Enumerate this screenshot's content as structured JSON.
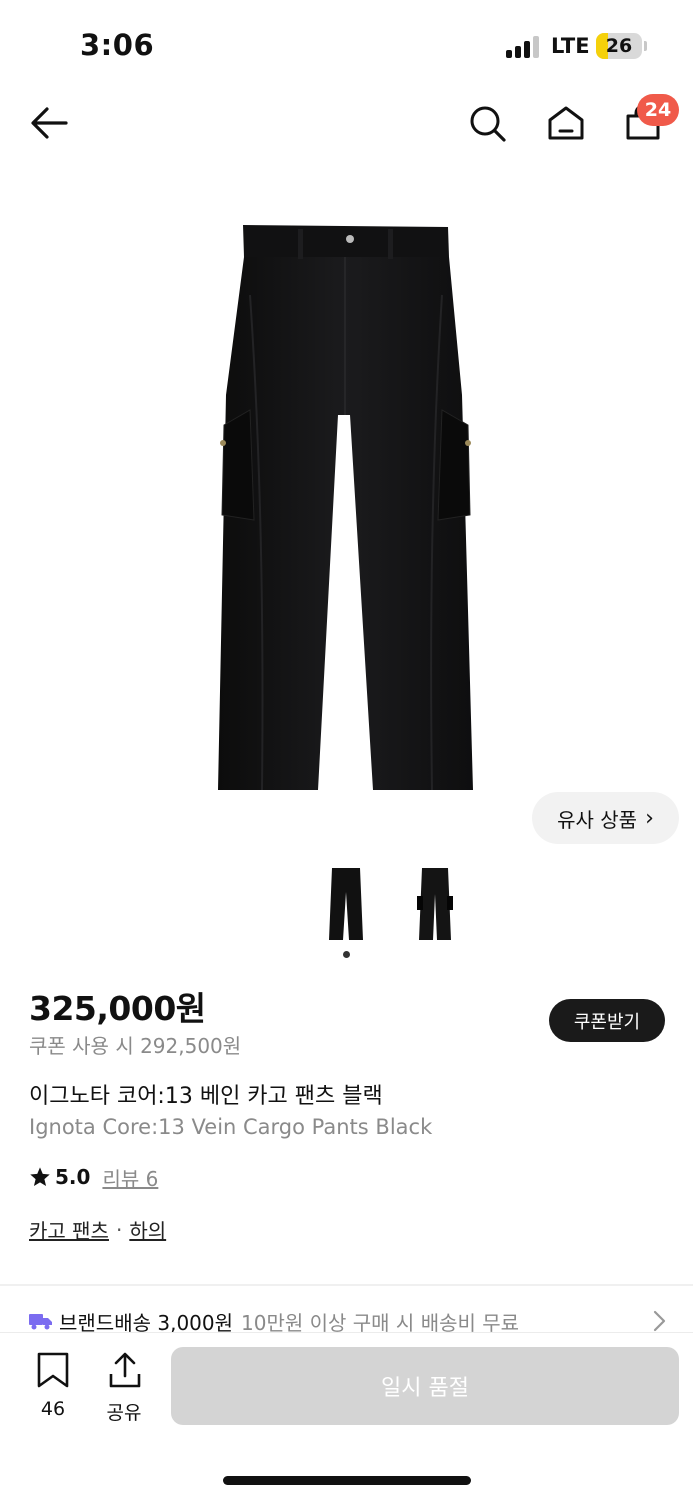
{
  "status_bar": {
    "time": "3:06",
    "network": "LTE",
    "battery": "26",
    "battery_level": 0.26,
    "signal_bars_active": 3,
    "signal_bars_total": 4
  },
  "nav": {
    "cart_count": "24",
    "icons": [
      "back-arrow-icon",
      "search-icon",
      "home-icon",
      "shopping-bag-icon"
    ]
  },
  "gallery": {
    "similar_label": "유사 상품",
    "thumbnail_count": 2,
    "active_index": 0
  },
  "product": {
    "price": "325,000원",
    "coupon_price": "쿠폰 사용 시 292,500원",
    "coupon_button": "쿠폰받기",
    "name_kr": "이그노타 코어:13 베인 카고 팬츠 블랙",
    "name_en": "Ignota Core:13 Vein Cargo Pants Black",
    "rating": "5.0",
    "review_link": "리뷰 6",
    "category": "카고 팬츠",
    "category_separator": "·",
    "parent_category": "하의"
  },
  "shipping": {
    "label": "브랜드배송 3,000원",
    "note": "10만원 이상 구매 시 배송비 무료"
  },
  "bottom_bar": {
    "bookmark_count": "46",
    "share_label": "공유",
    "soldout_label": "일시 품절"
  },
  "colors": {
    "badge": "#f05a4a",
    "battery": "#f5d10b",
    "coupon_button": "#1a1a1a",
    "soldout_button": "#d4d4d4",
    "shipping_icon": "#7b6cf0",
    "secondary_text": "#8a8a8a"
  }
}
